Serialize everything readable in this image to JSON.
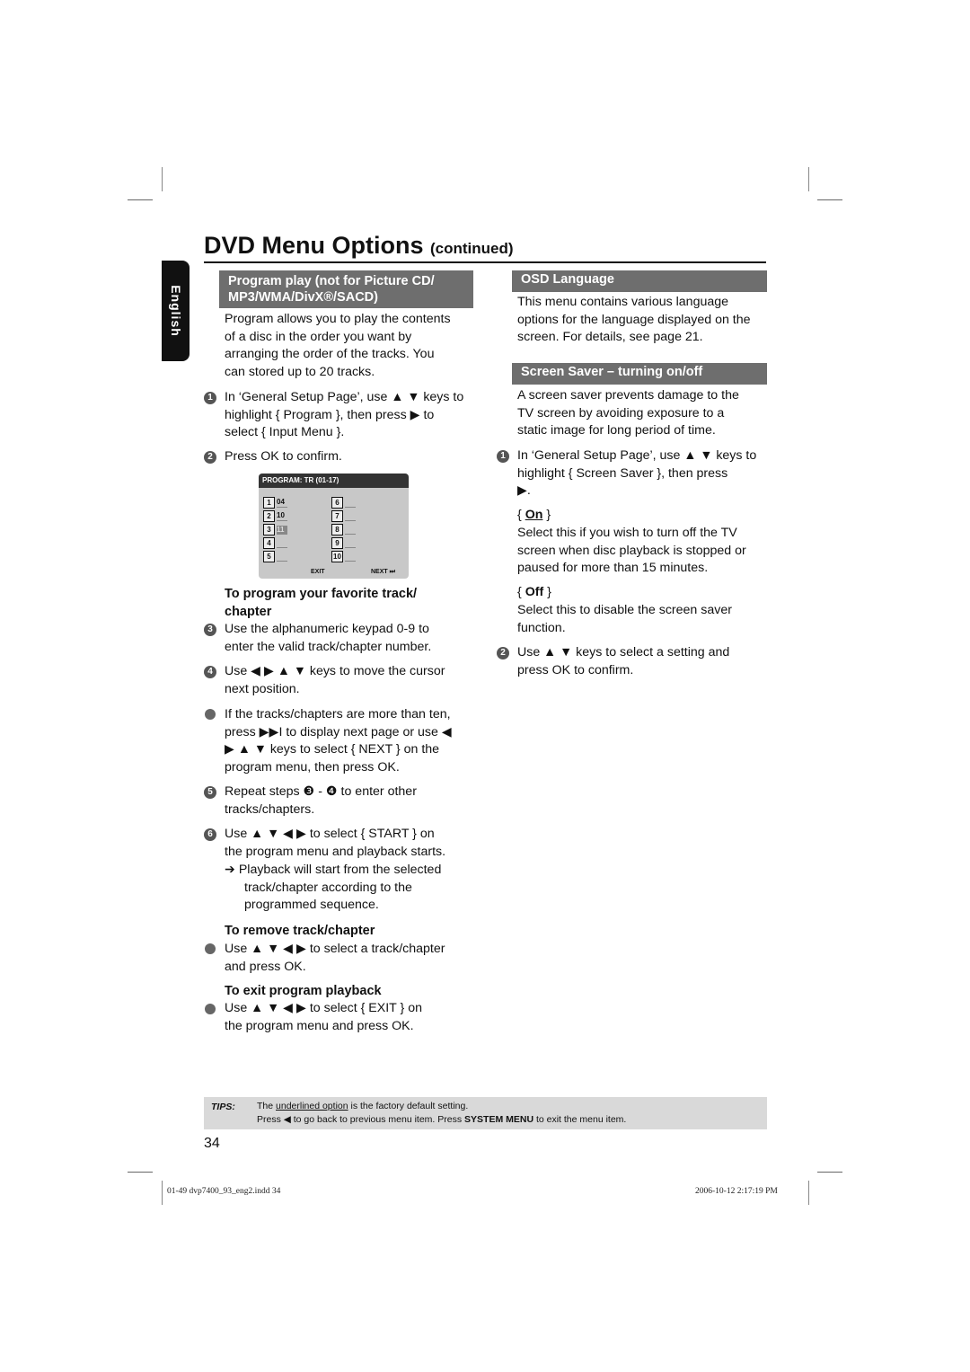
{
  "header": {
    "title": "DVD Menu Options",
    "title_suffix": "(continued)"
  },
  "language_tab": "English",
  "left": {
    "section_title_line1": "Program play (not for Picture CD/",
    "section_title_line2": "MP3/WMA/DivX®/SACD)",
    "intro": [
      "Program allows you to play the contents",
      "of a disc in the order you want by",
      "arranging the order of the tracks. You",
      "can stored up to 20 tracks."
    ],
    "step1": [
      "In ‘General Setup Page’, use ▲ ▼ keys to",
      "highlight { Program }, then press ▶ to",
      "select { Input Menu }."
    ],
    "step2": "Press OK to confirm.",
    "osd": {
      "title": "PROGRAM: TR (01-17)",
      "slots": [
        {
          "n": "1",
          "v": "04"
        },
        {
          "n": "2",
          "v": "10"
        },
        {
          "n": "3",
          "v": "11",
          "selected": true
        },
        {
          "n": "4",
          "v": ""
        },
        {
          "n": "5",
          "v": ""
        },
        {
          "n": "6",
          "v": ""
        },
        {
          "n": "7",
          "v": ""
        },
        {
          "n": "8",
          "v": ""
        },
        {
          "n": "9",
          "v": ""
        },
        {
          "n": "10",
          "v": ""
        }
      ],
      "exit_label": "EXIT",
      "next_label": "NEXT"
    },
    "sub1": [
      "To program your favorite track/",
      "chapter"
    ],
    "step3": [
      "Use the alphanumeric keypad 0-9 to",
      "enter the valid track/chapter number."
    ],
    "step4": [
      "Use ◀ ▶ ▲ ▼ keys to move the cursor",
      "next position."
    ],
    "bullet1": [
      "If the tracks/chapters are more than ten,",
      "press ▶▶I to display next page or use ◀",
      "▶ ▲ ▼ keys to select { NEXT } on the",
      "program menu, then press OK."
    ],
    "step5": [
      "Repeat steps ❸ - ❹ to enter other",
      "tracks/chapters."
    ],
    "step6": [
      "Use ▲ ▼ ◀ ▶ to select { START } on",
      "the program menu and playback starts."
    ],
    "result": [
      "➔ Playback will start from the selected",
      "track/chapter according to the",
      "programmed sequence."
    ],
    "sub2": "To remove track/chapter",
    "bullet2": [
      "Use ▲ ▼ ◀ ▶ to select a track/chapter",
      "and press OK."
    ],
    "sub3": "To exit program playback",
    "bullet3": [
      "Use ▲ ▼ ◀ ▶ to select { EXIT } on",
      "the program menu and press OK."
    ]
  },
  "right": {
    "osd_title": "OSD Language",
    "osd_text": [
      "This menu contains various language",
      "options for the language displayed on the",
      "screen. For details, see page 21."
    ],
    "ss_title": "Screen Saver – turning on/off",
    "ss_text": [
      "A screen saver prevents damage to the",
      "TV screen by avoiding exposure to a",
      "static image for long period of time."
    ],
    "step1": [
      "In ‘General Setup Page’, use ▲ ▼ keys to",
      "highlight { Screen Saver }, then press",
      "▶."
    ],
    "on_label": "On",
    "on_text": [
      "Select this if you wish to turn off the TV",
      "screen when disc playback is stopped or",
      "paused for more than 15 minutes."
    ],
    "off_label": "Off",
    "off_text": [
      "Select this to disable the screen saver",
      "function."
    ],
    "step2": [
      "Use ▲ ▼ keys to select a setting and",
      "press OK to confirm."
    ]
  },
  "tips": {
    "label": "TIPS:",
    "line1_pre": "The ",
    "line1_u": "underlined option",
    "line1_post": " is the factory default setting.",
    "line2_pre": "Press ◀ to go back to previous menu item. Press ",
    "line2_b": "SYSTEM MENU",
    "line2_post": " to exit the menu item."
  },
  "page_number": "34",
  "slug": {
    "file": "01-49 dvp7400_93_eng2.indd   34",
    "date": "2006-10-12   2:17:19 PM"
  }
}
